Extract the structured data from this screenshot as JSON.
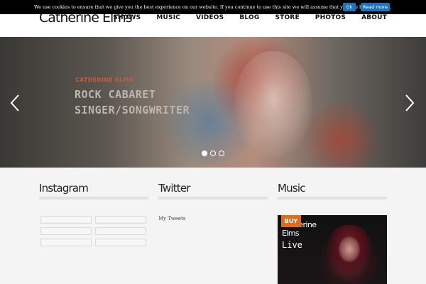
{
  "header": {
    "logo": "Catherine Elms",
    "nav": [
      "SHOWS",
      "MUSIC",
      "VIDEOS",
      "BLOG",
      "STORE",
      "PHOTOS",
      "ABOUT"
    ]
  },
  "cookie": {
    "text": "We use cookies to ensure that we give you the best experience on our website. If you continue to use this site we will assume that you are happy with it.",
    "ok_label": "Ok",
    "more_label": "Read more"
  },
  "hero": {
    "subtitle": "CATHERINE ELMS",
    "title_line1": "ROCK CABARET",
    "title_line2": "SINGER/SONGWRITER",
    "active_slide": 1
  },
  "sections": {
    "instagram_title": "Instagram",
    "twitter_title": "Twitter",
    "music_title": "Music",
    "tweets_link": "My Tweets"
  },
  "album": {
    "buy_label": "BUY",
    "artist": "Catherine Elms",
    "title": "Live"
  },
  "colors": {
    "accent_blue": "#1e73be",
    "buy_orange": "#e06a1f",
    "hero_subtitle": "#c85a3c"
  }
}
